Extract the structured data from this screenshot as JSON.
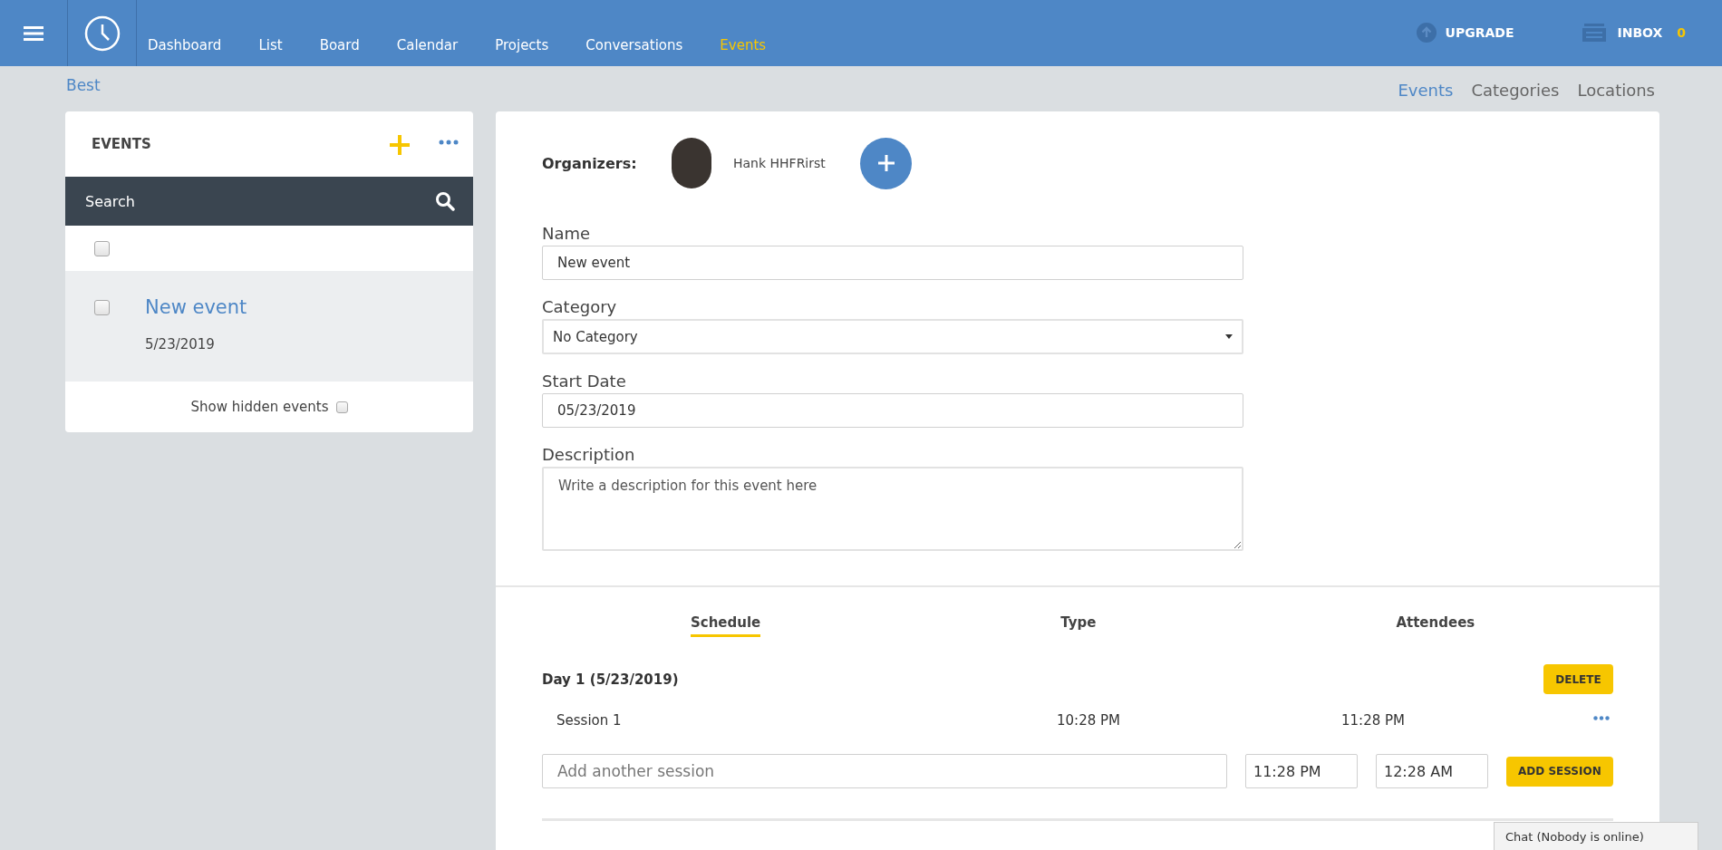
{
  "nav": {
    "items": [
      {
        "label": "Dashboard",
        "selected": false
      },
      {
        "label": "List",
        "selected": false
      },
      {
        "label": "Board",
        "selected": false
      },
      {
        "label": "Calendar",
        "selected": false
      },
      {
        "label": "Projects",
        "selected": false
      },
      {
        "label": "Conversations",
        "selected": false
      },
      {
        "label": "Events",
        "selected": true
      }
    ],
    "upgrade": "UPGRADE",
    "inbox": {
      "label": "INBOX",
      "count": "0"
    }
  },
  "breadcrumb": "Best",
  "subnav": [
    {
      "label": "Events",
      "selected": true
    },
    {
      "label": "Categories",
      "selected": false
    },
    {
      "label": "Locations",
      "selected": false
    }
  ],
  "events_panel": {
    "title": "EVENTS",
    "search": {
      "placeholder": "Search"
    },
    "select_all": {
      "checked": false
    },
    "items": [
      {
        "title": "New event",
        "date": "5/23/2019",
        "checked": false,
        "selected": true
      }
    ],
    "show_hidden": {
      "label": "Show hidden events",
      "checked": false
    }
  },
  "form": {
    "organizers_label": "Organizers:",
    "organizers": [
      {
        "name": "Hank HHFRirst"
      }
    ],
    "fields": [
      {
        "kind": "input",
        "label": "Name",
        "value": "New event"
      },
      {
        "kind": "select",
        "label": "Category",
        "value": "No Category"
      },
      {
        "kind": "input",
        "label": "Start Date",
        "value": "05/23/2019"
      },
      {
        "kind": "textarea",
        "label": "Description",
        "placeholder": "Write a description for this event here"
      }
    ]
  },
  "tabs": [
    {
      "label": "Schedule",
      "selected": true
    },
    {
      "label": "Type",
      "selected": false
    },
    {
      "label": "Attendees",
      "selected": false
    }
  ],
  "days": [
    {
      "title": "Day 1 (5/23/2019)",
      "delete_label": "DELETE",
      "sessions": [
        {
          "name": "Session 1",
          "start": "10:28 PM",
          "end": "11:28 PM"
        }
      ]
    }
  ],
  "add_session": {
    "placeholder": "Add another session",
    "start": "11:28 PM",
    "end": "12:28 AM",
    "button": "ADD SESSION"
  },
  "chat": "Chat (Nobody is online)"
}
